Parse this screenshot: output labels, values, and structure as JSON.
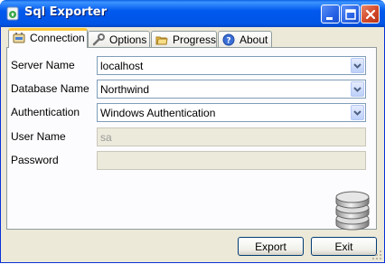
{
  "window": {
    "title": "Sql Exporter"
  },
  "title_buttons": {
    "minimize": "minimize-icon",
    "maximize": "maximize-icon",
    "close": "close-icon"
  },
  "tabs": [
    {
      "label": "Connection",
      "icon": "plug-icon",
      "active": true
    },
    {
      "label": "Options",
      "icon": "wrench-icon",
      "active": false
    },
    {
      "label": "Progress",
      "icon": "folders-icon",
      "active": false
    },
    {
      "label": "About",
      "icon": "help-icon",
      "active": false
    }
  ],
  "form": {
    "server_label": "Server Name",
    "server_value": "localhost",
    "database_label": "Database Name",
    "database_value": "Northwind",
    "auth_label": "Authentication",
    "auth_value": "Windows Authentication",
    "user_label": "User Name",
    "user_value": "sa",
    "password_label": "Password",
    "password_value": ""
  },
  "buttons": {
    "export": "Export",
    "exit": "Exit"
  },
  "colors": {
    "titlebar": "#0058ee",
    "active_tab_accent": "#ffc83c",
    "dialog_bg": "#ece9d8"
  }
}
